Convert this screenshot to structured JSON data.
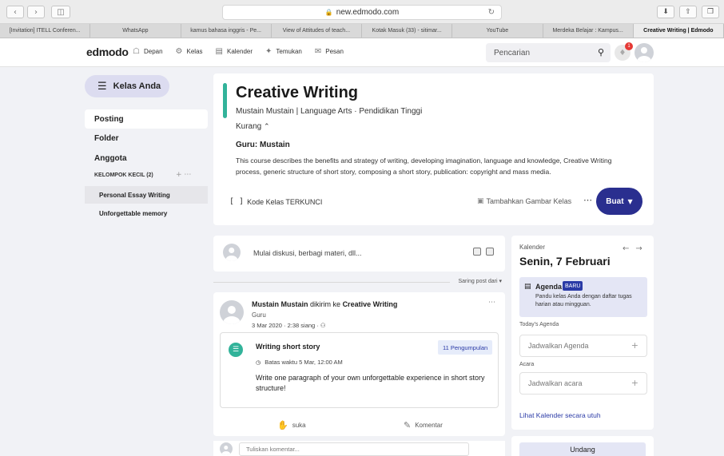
{
  "browser": {
    "url": "new.edmodo.com",
    "tabs": [
      "[Invitation] ITELL Conferen...",
      "WhatsApp",
      "kamus bahasa inggris - Pe...",
      "View of Attitudes of teach...",
      "Kotak Masuk (33) - sitimar...",
      "YouTube",
      "Merdeka Belajar : Kampus...",
      "Creative Writing | Edmodo"
    ]
  },
  "header": {
    "logo": "edmodo",
    "nav": [
      "Depan",
      "Kelas",
      "Kalender",
      "Temukan",
      "Pesan"
    ],
    "search_placeholder": "Pencarian"
  },
  "sidebar": {
    "title": "Kelas Anda",
    "items": [
      "Posting",
      "Folder",
      "Anggota"
    ],
    "group": "KELOMPOK KECIL (2)",
    "groups": [
      "Personal Essay Writing",
      "Unforgettable memory"
    ]
  },
  "class": {
    "title": "Creative Writing",
    "meta": "Mustain Mustain | Language Arts  · Pendidikan Tinggi",
    "less": "Kurang",
    "teacher": "Guru: Mustain",
    "description": "This course describes the benefits and strategy of writing, developing imagination, language and knowledge, Creative Writing process, generic structure of short story, composing a short story, publication: copyright and mass media.",
    "code": "Kode Kelas TERKUNCI",
    "add_image": "Tambahkan Gambar Kelas",
    "create": "Buat"
  },
  "composer": {
    "placeholder": "Mulai diskusi, berbagi materi, dll...",
    "filter": "Saring post dari"
  },
  "post": {
    "author": "Mustain Mustain",
    "sent_to": "dikirim ke",
    "target": "Creative Writing",
    "role": "Guru",
    "time": "3 Mar 2020 · 2:38 siang ·",
    "assignment_title": "Writing short story",
    "submissions": "11 Pengumpulan",
    "deadline": "Batas waktu 5 Mar, 12:00 AM",
    "text": "Write one paragraph of your own unforgettable experience in short story structure!",
    "like": "suka",
    "comment": "Komentar",
    "comment_placeholder": "Tuliskan komentar..."
  },
  "calendar": {
    "label": "Kalender",
    "date": "Senin, 7 Februari",
    "agenda_title": "Agenda",
    "agenda_new": "BARU",
    "agenda_desc": "Pandu kelas Anda dengan daftar tugas harian atau mingguan.",
    "today_label": "Today's Agenda",
    "schedule_agenda": "Jadwalkan Agenda",
    "events_label": "Acara",
    "schedule_event": "Jadwalkan acara",
    "view_all": "Lihat Kalender secara utuh"
  },
  "invite": {
    "label": "Undang"
  },
  "notifications": {
    "count": "1"
  }
}
